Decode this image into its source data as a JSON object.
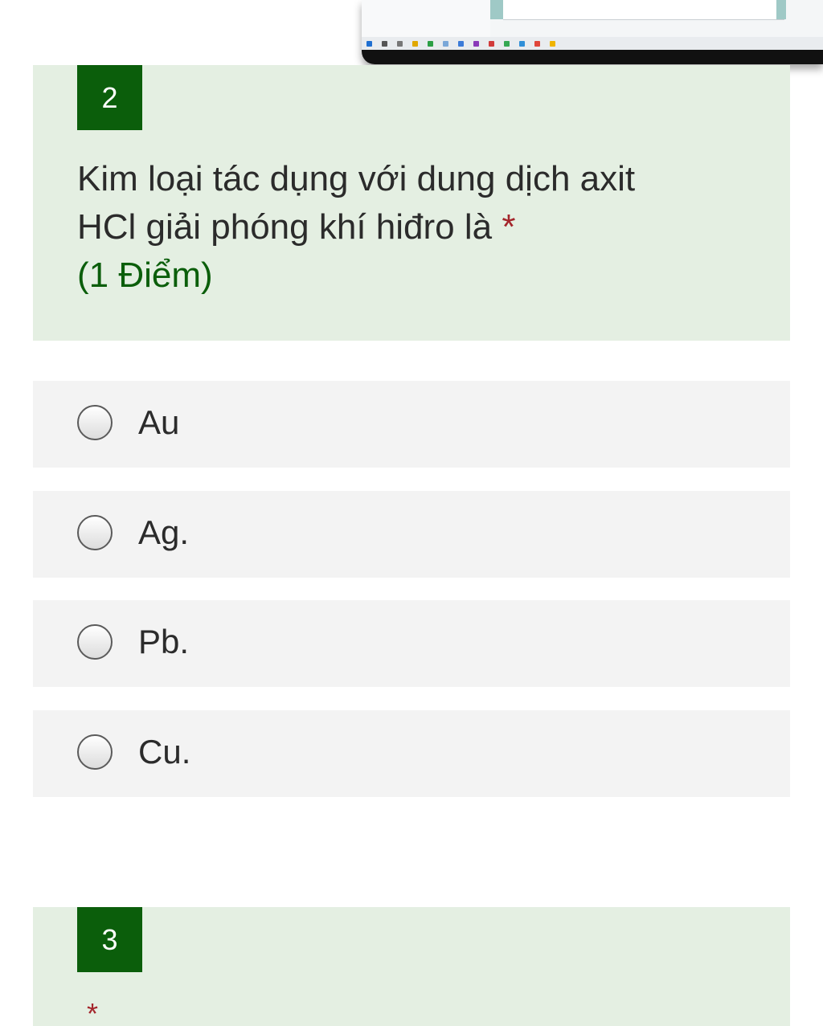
{
  "question": {
    "number": "2",
    "text_line1": "Kim loại tác dụng với dung dịch axit",
    "text_line2": "HCl giải phóng khí hiđro là",
    "required_mark": "*",
    "points": "(1 Điểm)"
  },
  "options": [
    {
      "label": "Au",
      "selected": false
    },
    {
      "label": "Ag.",
      "selected": false
    },
    {
      "label": "Pb.",
      "selected": false
    },
    {
      "label": "Cu.",
      "selected": false
    }
  ],
  "next_question": {
    "number": "3",
    "required_mark": "*"
  },
  "colors": {
    "accent": "#0b5e0b",
    "card_background": "#e4efe2",
    "option_background": "#f3f3f3",
    "required": "#a4262c"
  }
}
